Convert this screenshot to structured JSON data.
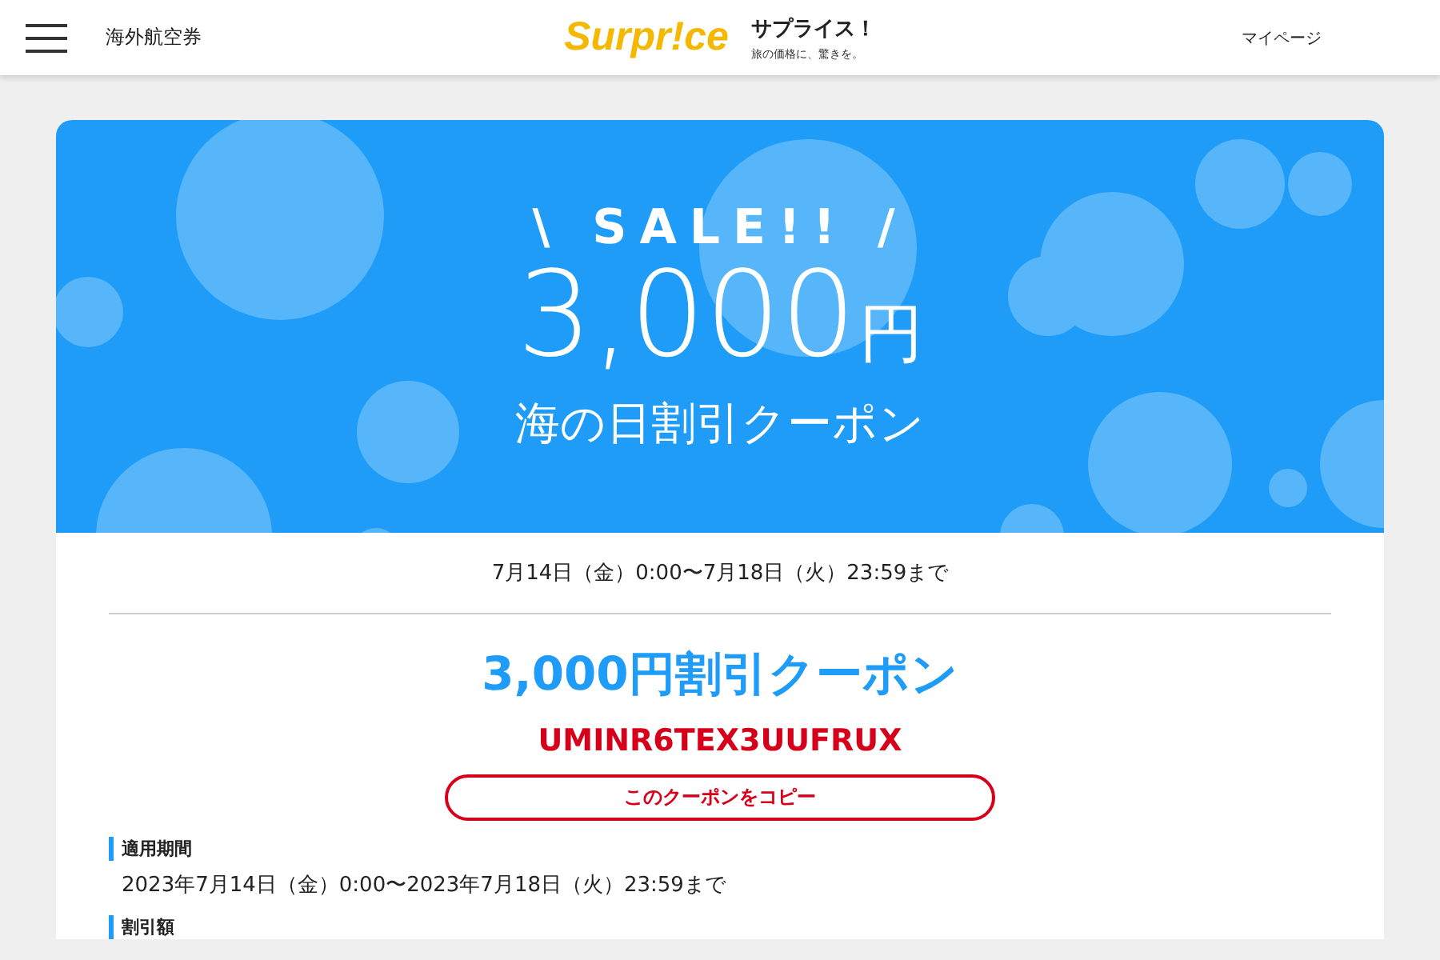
{
  "header": {
    "nav_label": "海外航空券",
    "logo": "Surpr!ce",
    "brand_name": "サプライス！",
    "tagline": "旅の価格に、驚きを。",
    "mypage": "マイページ"
  },
  "banner": {
    "sale": "\\ SALE!! /",
    "amount": "3,000",
    "unit": "円",
    "title": "海の日割引クーポン"
  },
  "period_short": "7月14日（金）0:00〜7月18日（火）23:59まで",
  "coupon": {
    "title": "3,000円割引クーポン",
    "code": "UMINR6TEX3UUFRUX",
    "copy_button": "このクーポンをコピー"
  },
  "sections": [
    {
      "heading": "適用期間",
      "body": "2023年7月14日（金）0:00〜2023年7月18日（火）23:59まで"
    },
    {
      "heading": "割引額"
    }
  ]
}
